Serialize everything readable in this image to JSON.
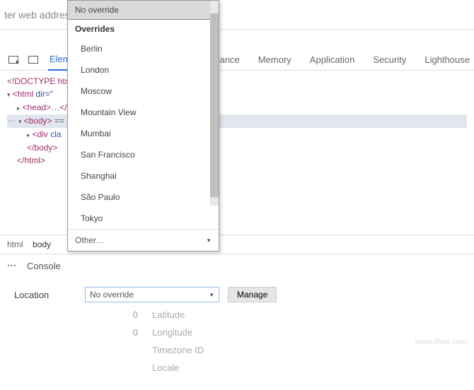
{
  "addrbar": {
    "placeholder": "ter web address"
  },
  "tabs": {
    "elements": "Elements",
    "right": [
      "Performance",
      "Memory",
      "Application",
      "Security",
      "Lighthouse"
    ]
  },
  "dom": {
    "doctype": "<!DOCTYPE html",
    "html_open": "<html ",
    "html_attr": "dir=\"",
    "head_open": "<head>",
    "head_ellipsis": "…",
    "head_close": "</head>",
    "body_open": "<body>",
    "body_sel_tail": " == ",
    "div_open": "<div ",
    "div_attr": "cla",
    "body_close": "</body>",
    "html_close": "</html>"
  },
  "crumbs": {
    "html": "html",
    "body": "body"
  },
  "drawer": {
    "console": "Console"
  },
  "sensors": {
    "location_label": "Location",
    "select_value": "No override",
    "manage": "Manage",
    "fields": {
      "lat": {
        "value": "0",
        "label": "Latitude"
      },
      "lon": {
        "value": "0",
        "label": "Longitude"
      },
      "tz": {
        "value": "",
        "label": "Timezone ID"
      },
      "loc": {
        "value": "",
        "label": "Locale"
      }
    }
  },
  "dropdown": {
    "header": "No override",
    "subheader": "Overrides",
    "options": [
      "Berlin",
      "London",
      "Moscow",
      "Mountain View",
      "Mumbai",
      "San Francisco",
      "Shanghai",
      "São Paulo",
      "Tokyo"
    ],
    "other": "Other…"
  },
  "watermark": "www.lifam.com"
}
